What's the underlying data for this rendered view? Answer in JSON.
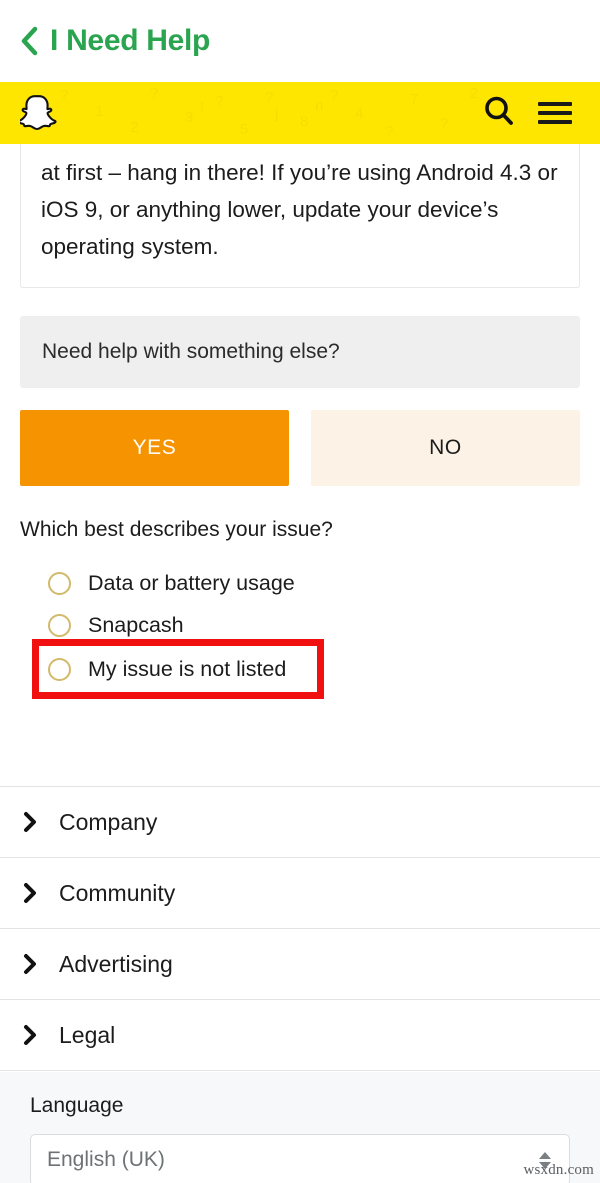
{
  "header": {
    "back_icon": "chevron-left-icon",
    "title": "I Need Help",
    "title_color": "#2aa44f"
  },
  "brand_bar": {
    "background_color": "#FFE600",
    "logo": "snapchat-ghost-logo",
    "search_icon": "search-icon",
    "menu_icon": "hamburger-menu-icon"
  },
  "answer_card": {
    "text": "at first – hang in there! If you’re using Android 4.3 or iOS 9, or anything lower, update your device’s operating system."
  },
  "prompt": {
    "text": "Need help with something else?",
    "background_color": "#efefef"
  },
  "choices": {
    "yes_label": "YES",
    "no_label": "NO",
    "yes_color": "#F59300",
    "no_color": "#FCF2E6"
  },
  "question": {
    "label": "Which best describes your issue?",
    "options": [
      {
        "label": "Data or battery usage",
        "selected": false,
        "highlighted": false
      },
      {
        "label": "Snapcash",
        "selected": false,
        "highlighted": false
      },
      {
        "label": "My issue is not listed",
        "selected": false,
        "highlighted": true
      }
    ],
    "radio_border_color": "#d3b96a",
    "highlight_color": "#F01010"
  },
  "nav_sections": [
    {
      "label": "Company",
      "icon": "chevron-right-icon"
    },
    {
      "label": "Community",
      "icon": "chevron-right-icon"
    },
    {
      "label": "Advertising",
      "icon": "chevron-right-icon"
    },
    {
      "label": "Legal",
      "icon": "chevron-right-icon"
    }
  ],
  "language": {
    "label": "Language",
    "value": "English (UK)",
    "spinner_icon": "updown-spinner-icon"
  },
  "watermark": {
    "text": "wsxdn.com"
  }
}
